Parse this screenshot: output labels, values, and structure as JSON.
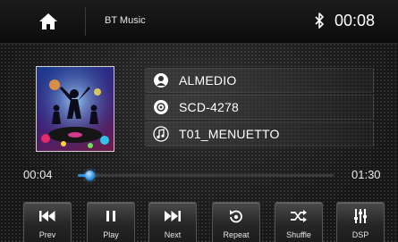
{
  "status_bar": {
    "source": "BT Music",
    "clock": "00:08",
    "icons": [
      "home-icon",
      "bluetooth-icon"
    ]
  },
  "track": {
    "artist": "ALMEDIO",
    "album": "SCD-4278",
    "title": "T01_MENUETTO",
    "icons": [
      "artist-icon",
      "album-disc-icon",
      "music-note-icon"
    ]
  },
  "progress": {
    "elapsed": "00:04",
    "total": "01:30",
    "fraction": 0.044,
    "accent_color": "#2f8fe0"
  },
  "controls": [
    {
      "id": "prev",
      "label": "Prev",
      "icon": "skip-previous-icon"
    },
    {
      "id": "play",
      "label": "Play",
      "icon": "pause-icon"
    },
    {
      "id": "next",
      "label": "Next",
      "icon": "skip-next-icon"
    },
    {
      "id": "repeat",
      "label": "Repeat",
      "icon": "repeat-icon"
    },
    {
      "id": "shuffle",
      "label": "Shuffle",
      "icon": "shuffle-icon"
    },
    {
      "id": "dsp",
      "label": "DSP",
      "icon": "equalizer-icon"
    }
  ]
}
